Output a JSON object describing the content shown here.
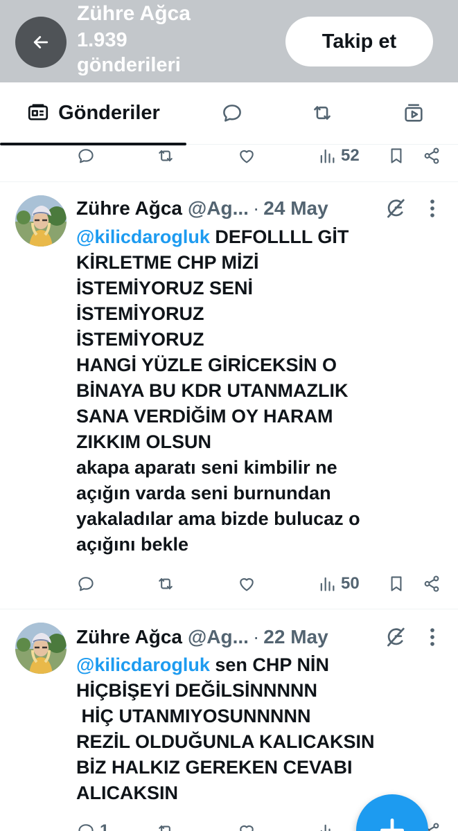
{
  "header": {
    "name": "Zühre Ağca",
    "post_count": "1.939 gönderileri",
    "follow_label": "Takip et"
  },
  "tabs": {
    "posts_label": "Gönderiler"
  },
  "top_actions": {
    "views": "52"
  },
  "tweets": [
    {
      "name": "Zühre Ağca",
      "handle": "@Ag...",
      "dot": "·",
      "date": "24 May",
      "mention": "@kilicdarogluk",
      "text": " DEFOLLLL GİT\nKİRLETME CHP MİZİ\nİSTEMİYORUZ SENİ\nİSTEMİYORUZ\nİSTEMİYORUZ\nHANGİ YÜZLE GİRİCEKSİN O\nBİNAYA BU KDR UTANMAZLIK\nSANA VERDİĞİM OY HARAM\nZIKKIM OLSUN\nakapa aparatı seni kimbilir ne\naçığın varda seni burnundan\nyakaladılar ama bizde bulucaz o\naçığını bekle",
      "views": "50"
    },
    {
      "name": "Zühre Ağca",
      "handle": "@Ag...",
      "dot": "·",
      "date": "22 May",
      "mention": "@kilicdarogluk",
      "text": " sen CHP NİN\nHİÇBİŞEYİ DEĞİLSİNNNNN\n HİÇ UTANMIYOSUNNNNN\nREZİL OLDUĞUNLA KALICAKSIN\nBİZ HALKIZ GEREKEN CEVABI\nALICAKSIN",
      "replies": "1"
    }
  ],
  "colors": {
    "accent": "#1d9bf0",
    "header_bg": "#c3c7cb",
    "muted": "#536471"
  },
  "icons": [
    "back-arrow-icon",
    "posts-tab-icon",
    "reply-icon",
    "repost-icon",
    "like-icon",
    "views-icon",
    "bookmark-icon",
    "share-icon",
    "grok-icon",
    "more-icon",
    "compose-plus-icon"
  ]
}
